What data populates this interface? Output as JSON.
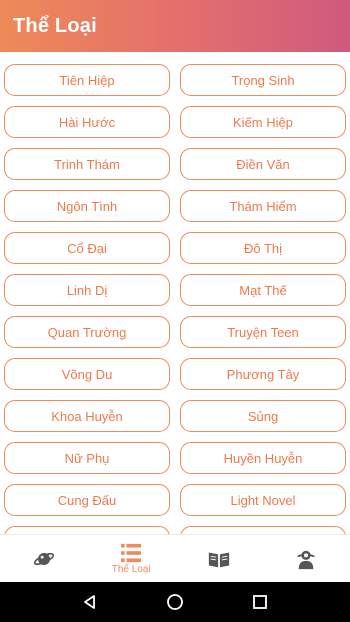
{
  "header": {
    "title": "Thể Loại"
  },
  "genres": [
    "Tiên Hiệp",
    "Trọng Sinh",
    "Hài Hước",
    "Kiếm Hiệp",
    "Trinh Thám",
    "Điền Văn",
    "Ngôn Tình",
    "Thám Hiểm",
    "Cổ Đại",
    "Đô Thị",
    "Linh Dị",
    "Mạt Thế",
    "Quan Trường",
    "Truyện Teen",
    "Võng Du",
    "Phương Tây",
    "Khoa Huyễn",
    "Sủng",
    "Nữ Phụ",
    "Huyền Huyễn",
    "Cung Đấu",
    "Light Novel"
  ],
  "bottom_nav": {
    "items": [
      {
        "icon": "planet-icon",
        "label": ""
      },
      {
        "icon": "list-icon",
        "label": "Thể Loại",
        "active": true
      },
      {
        "icon": "book-icon",
        "label": ""
      },
      {
        "icon": "user-icon",
        "label": ""
      }
    ]
  },
  "colors": {
    "accent": "#ee8a58",
    "accent_end": "#cf5a7e",
    "inactive_icon": "#555555"
  }
}
